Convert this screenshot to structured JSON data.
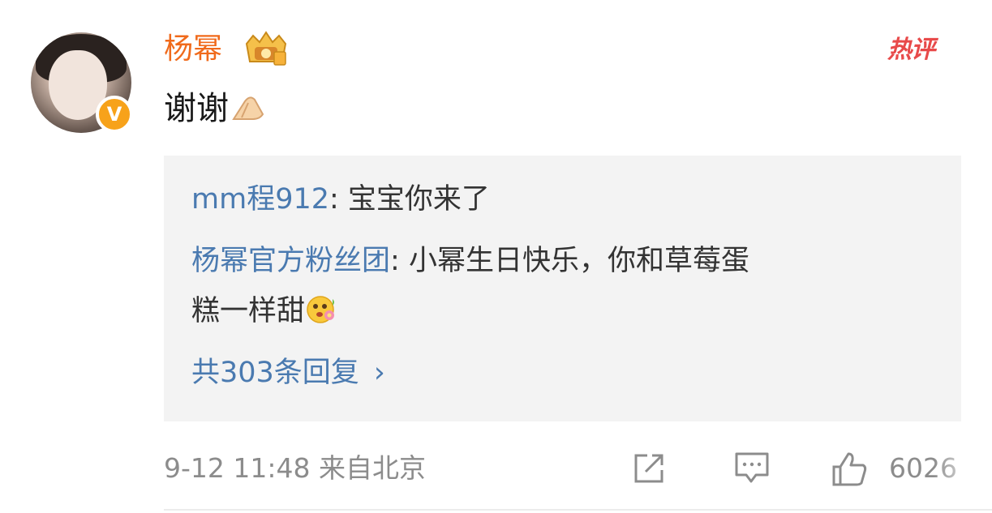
{
  "comment": {
    "username": "杨幂",
    "text": "谢谢",
    "hot_label": "热评",
    "badge_letter": "V"
  },
  "replies": [
    {
      "author": "mm程912",
      "separator": ": ",
      "text": "宝宝你来了"
    },
    {
      "author": "杨幂官方粉丝团",
      "separator": ": ",
      "text_line1": "小幂生日快乐，你和草莓蛋",
      "text_line2": "糕一样甜"
    }
  ],
  "more_replies": {
    "label": "共303条回复",
    "chevron": "›"
  },
  "footer": {
    "timestamp": "9-12 11:48 来自北京",
    "like_count": "6026"
  },
  "colors": {
    "username": "#f06a1b",
    "link": "#4a7ab0",
    "hot": "#e84a4a",
    "verified": "#f7a21a",
    "meta": "#8c8c8c"
  },
  "icons": [
    "crown-badge-icon",
    "verified-v-icon",
    "praying-hands-icon",
    "flower-face-icon",
    "share-icon",
    "comment-icon",
    "like-icon"
  ]
}
